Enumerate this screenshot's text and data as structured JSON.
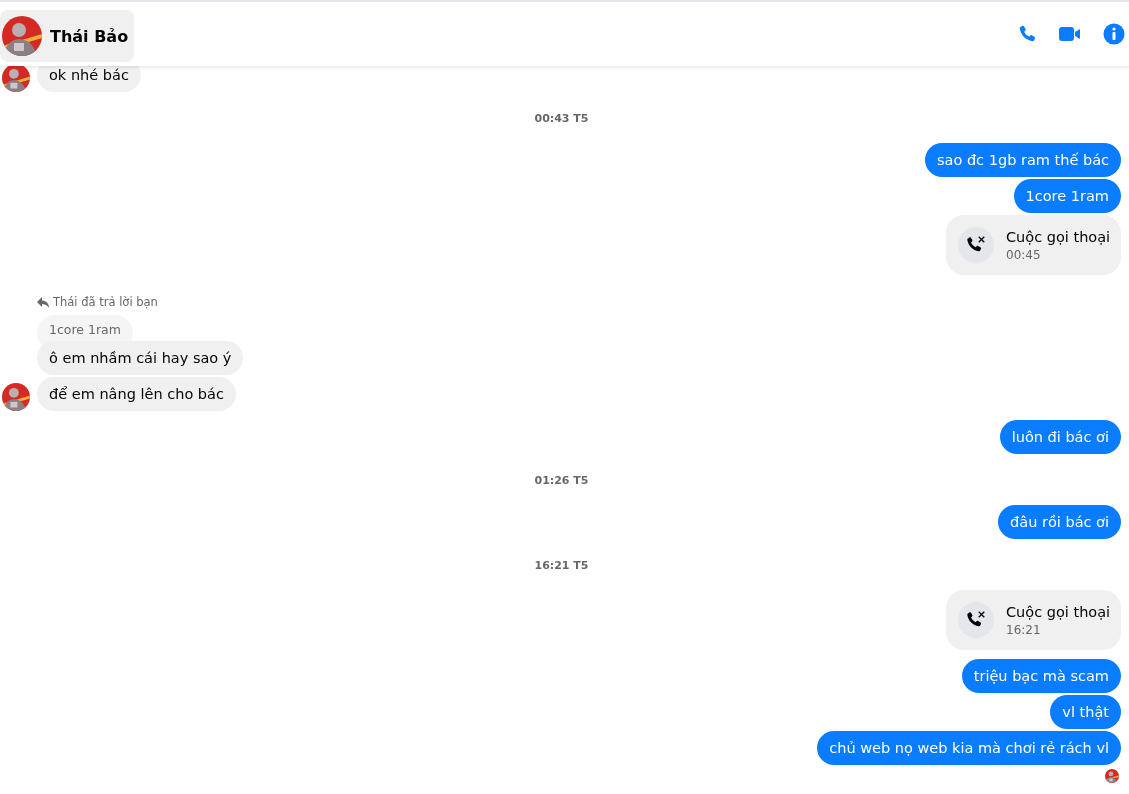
{
  "header": {
    "name": "Thái Bảo"
  },
  "messages": [
    {
      "kind": "in",
      "text": "ok nhé bác",
      "avatar": true
    },
    {
      "kind": "time",
      "text": "00:43 T5"
    },
    {
      "kind": "out",
      "text": "sao đc 1gb ram thế bác"
    },
    {
      "kind": "out",
      "text": "1core 1ram"
    },
    {
      "kind": "call",
      "title": "Cuộc gọi thoại",
      "time": "00:45"
    },
    {
      "kind": "reply",
      "text": "Thái đã trả lời bạn"
    },
    {
      "kind": "quote",
      "text": "1core 1ram"
    },
    {
      "kind": "in",
      "text": "ô em nhầm cái hay sao ý",
      "avatar": false
    },
    {
      "kind": "in",
      "text": "để em nâng lên cho bác",
      "avatar": true
    },
    {
      "kind": "out",
      "text": "luôn đi bác ơi"
    },
    {
      "kind": "time",
      "text": "01:26 T5"
    },
    {
      "kind": "out",
      "text": "đâu rồi bác ơi"
    },
    {
      "kind": "time",
      "text": "16:21 T5"
    },
    {
      "kind": "call",
      "title": "Cuộc gọi thoại",
      "time": "16:21"
    },
    {
      "kind": "out",
      "text": "triệu bạc mà scam"
    },
    {
      "kind": "out",
      "text": "vl thật"
    },
    {
      "kind": "out",
      "text": "chủ web nọ web kia mà chơi rẻ rách vl"
    },
    {
      "kind": "seen"
    }
  ]
}
